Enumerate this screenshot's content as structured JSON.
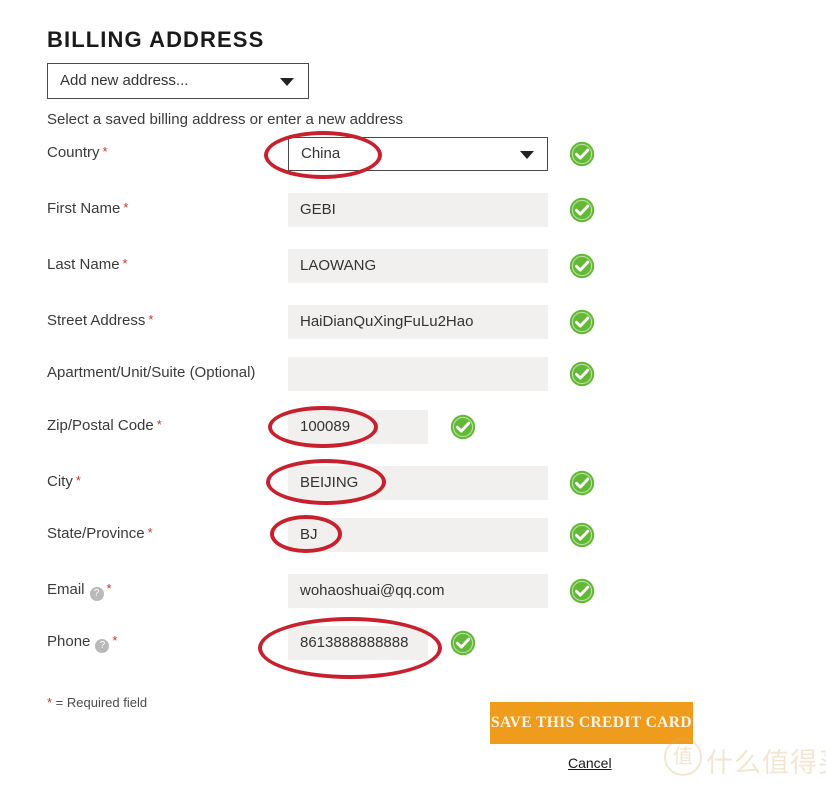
{
  "page": {
    "title": "BILLING ADDRESS",
    "helper_text": "Select a saved billing address or enter a new address",
    "required_note_star": "*",
    "required_note_text": " = Required field"
  },
  "saved_address_select": {
    "value": "Add new address...",
    "icon": "chevron-down-icon"
  },
  "fields": [
    {
      "label": "Country",
      "required_marker": "*",
      "value": "China",
      "control": "select",
      "width": "wide",
      "check": "far",
      "has_help": false,
      "annotated": true
    },
    {
      "label": "First Name",
      "required_marker": "*",
      "value": "GEBI",
      "control": "text",
      "width": "wide",
      "check": "far",
      "has_help": false,
      "annotated": false
    },
    {
      "label": "Last Name",
      "required_marker": "*",
      "value": "LAOWANG",
      "control": "text",
      "width": "wide",
      "check": "far",
      "has_help": false,
      "annotated": false
    },
    {
      "label": "Street Address",
      "required_marker": "*",
      "value": "HaiDianQuXingFuLu2Hao",
      "control": "text",
      "width": "wide",
      "check": "far",
      "has_help": false,
      "annotated": false
    },
    {
      "label": "Apartment/Unit/Suite (Optional)",
      "required_marker": "",
      "value": "",
      "control": "text",
      "width": "wide",
      "check": "far",
      "has_help": false,
      "annotated": false
    },
    {
      "label": "Zip/Postal Code",
      "required_marker": "*",
      "value": "100089",
      "control": "text",
      "width": "narrow",
      "check": "near",
      "has_help": false,
      "annotated": true
    },
    {
      "label": "City",
      "required_marker": "*",
      "value": "BEIJING",
      "control": "text",
      "width": "wide",
      "check": "far",
      "has_help": false,
      "annotated": true
    },
    {
      "label": "State/Province",
      "required_marker": "*",
      "value": "BJ",
      "control": "text",
      "width": "wide",
      "check": "far",
      "has_help": false,
      "annotated": true
    },
    {
      "label": "Email",
      "required_marker": "*",
      "value": "wohaoshuai@qq.com",
      "control": "text",
      "width": "wide",
      "check": "far",
      "has_help": true,
      "help_icon_glyph": "?",
      "annotated": false
    },
    {
      "label": "Phone",
      "required_marker": "*",
      "value": "8613888888888",
      "control": "text",
      "width": "narrow",
      "check": "near",
      "has_help": true,
      "help_icon_glyph": "?",
      "annotated": true
    }
  ],
  "actions": {
    "save_label": "SAVE THIS CREDIT CARD",
    "cancel_label": "Cancel"
  },
  "watermark": {
    "badge": "值",
    "text": "什么值得买"
  },
  "colors": {
    "valid_green": "#63b936",
    "button_orange": "#ef9c1c",
    "annotation_red": "#c8202c",
    "field_background": "#f1f0ee",
    "required_red": "#c0392b"
  }
}
